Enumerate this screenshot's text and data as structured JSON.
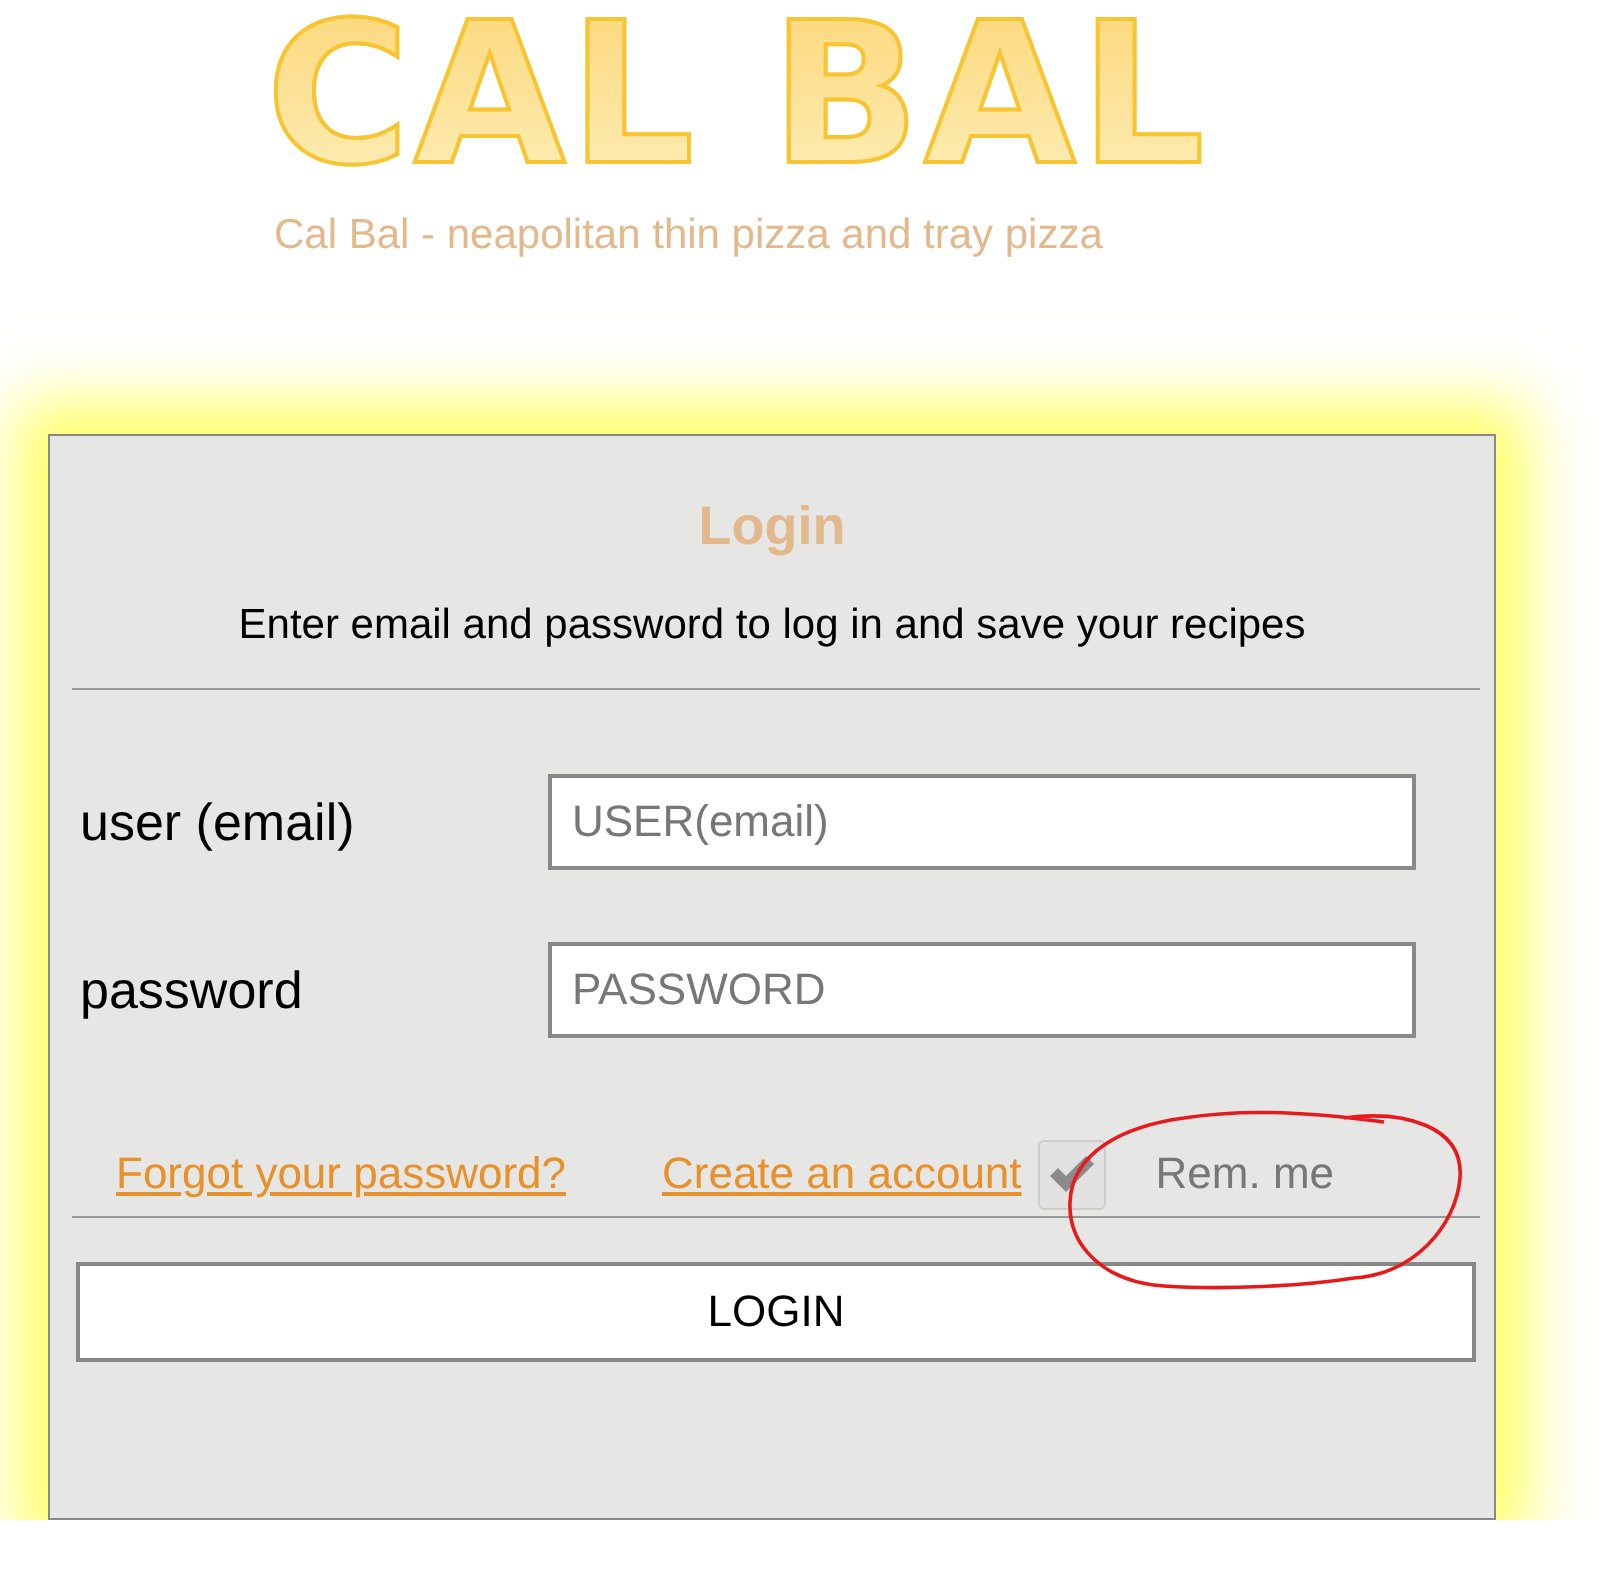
{
  "logo": "CAL BAL",
  "tagline": "Cal Bal - neapolitan thin pizza and tray pizza",
  "login": {
    "title": "Login",
    "subtitle": "Enter email and password to log in and save your recipes",
    "fields": [
      {
        "label": "user (email)",
        "placeholder": "USER(email)"
      },
      {
        "label": "password",
        "placeholder": "PASSWORD"
      }
    ],
    "links": [
      "Forgot your password?",
      "Create an account"
    ],
    "remember": {
      "label": "Rem. me",
      "checked": true,
      "disabled": true
    },
    "button": "LOGIN"
  }
}
